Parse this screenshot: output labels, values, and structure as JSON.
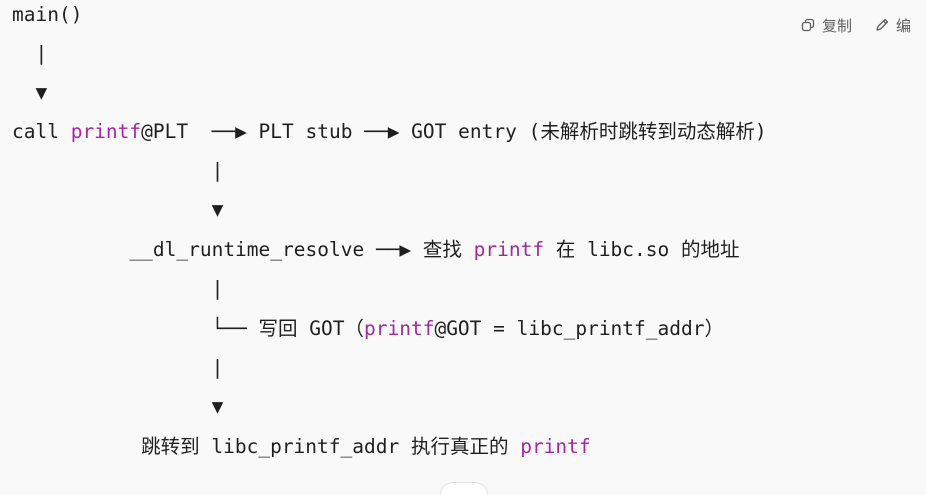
{
  "toolbar": {
    "copy_label": "复制",
    "edit_label": "编",
    "copy_icon": "copy-icon",
    "edit_icon": "pencil-icon"
  },
  "code": {
    "l1": "main()",
    "l2": "  |",
    "l3": "  ▼",
    "l4_pre": "call ",
    "l4_kw": "printf",
    "l4_post": "@PLT  ──▶ PLT stub ──▶ GOT entry (未解析时跳转到动态解析)",
    "l5": "                 |",
    "l6": "                 ▼",
    "l7_pre": "          __dl_runtime_resolve ──▶ 查找 ",
    "l7_kw": "printf",
    "l7_post": " 在 libc.so 的地址",
    "l8": "                 |",
    "l9_pre": "                 └── 写回 GOT（",
    "l9_kw": "printf",
    "l9_post": "@GOT = libc_printf_addr）",
    "l10": "                 |",
    "l11": "                 ▼",
    "l12_pre": "           跳转到 libc_printf_addr 执行真正的 ",
    "l12_kw": "printf"
  },
  "colors": {
    "keyword": "#a626a4",
    "text": "#1f1f1f",
    "background": "#f9f9f9"
  }
}
